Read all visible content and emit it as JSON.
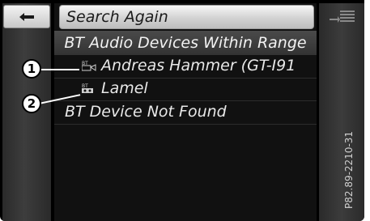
{
  "search_again_label": "Search Again",
  "header_title": "BT Audio Devices Within Range",
  "devices": [
    {
      "name": "Andreas Hammer (GT-I91",
      "icon": "bt-phone-icon"
    },
    {
      "name": "Lamel",
      "icon": "bt-audio-icon"
    }
  ],
  "not_found_label": "BT Device Not Found",
  "callouts": [
    "1",
    "2"
  ],
  "figure_ref": "P82.89-2210-31",
  "icons": {
    "back": "back-arrow-icon",
    "menu": "menu-list-icon"
  }
}
